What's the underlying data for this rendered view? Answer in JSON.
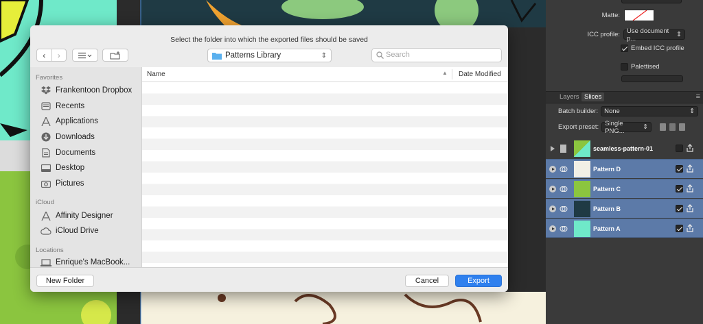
{
  "dialog": {
    "message": "Select the folder into which the exported files should be saved",
    "location": "Patterns Library",
    "search_placeholder": "Search",
    "columns": [
      "Name",
      "Date Modified"
    ],
    "new_folder_label": "New Folder",
    "cancel_label": "Cancel",
    "export_label": "Export",
    "sidebar": {
      "favorites_header": "Favorites",
      "favorites": [
        "Frankentoon Dropbox",
        "Recents",
        "Applications",
        "Downloads",
        "Documents",
        "Desktop",
        "Pictures"
      ],
      "icloud_header": "iCloud",
      "icloud": [
        "Affinity Designer",
        "iCloud Drive"
      ],
      "locations_header": "Locations",
      "locations": [
        "Enrique's MacBook..."
      ]
    }
  },
  "right_panel": {
    "matte_label": "Matte:",
    "icc_label": "ICC profile:",
    "icc_value": "Use document p...",
    "embed_icc_label": "Embed ICC profile",
    "embed_icc_checked": true,
    "palettised_label": "Palettised",
    "palettised_checked": false,
    "tabs": [
      "Layers",
      "Slices"
    ],
    "active_tab": "Slices",
    "batch_builder_label": "Batch builder:",
    "batch_builder_value": "None",
    "export_preset_label": "Export preset:",
    "export_preset_value": "Single PNG...",
    "slices": [
      {
        "name": "seamless-pattern-01",
        "selected": false,
        "checked": false
      },
      {
        "name": "Pattern D",
        "selected": true,
        "checked": true
      },
      {
        "name": "Pattern C",
        "selected": true,
        "checked": true
      },
      {
        "name": "Pattern B",
        "selected": true,
        "checked": true
      },
      {
        "name": "Pattern A",
        "selected": true,
        "checked": true
      }
    ]
  },
  "colors": {
    "accent": "#2f80ee",
    "selection": "#5c7aa8",
    "panel": "#3a3a3a"
  }
}
